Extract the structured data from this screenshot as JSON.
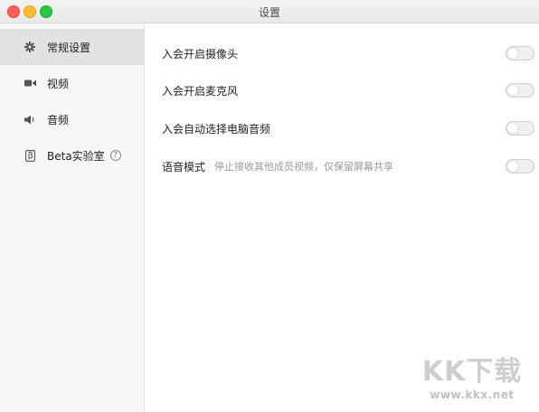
{
  "window": {
    "title": "设置",
    "colors": {
      "close": "#fe5f57",
      "minimize": "#febc2e",
      "maximize": "#28c840"
    }
  },
  "sidebar": {
    "items": [
      {
        "label": "常规设置",
        "icon": "gear-icon",
        "active": true
      },
      {
        "label": "视频",
        "icon": "video-camera-icon",
        "active": false
      },
      {
        "label": "音频",
        "icon": "speaker-icon",
        "active": false
      },
      {
        "label": "Beta实验室",
        "icon": "beta-icon",
        "active": false,
        "has_help": true
      }
    ]
  },
  "settings": {
    "rows": [
      {
        "label": "入会开启摄像头",
        "enabled": false
      },
      {
        "label": "入会开启麦克风",
        "enabled": false
      },
      {
        "label": "入会自动选择电脑音频",
        "enabled": false
      },
      {
        "label": "语音模式",
        "description": "停止接收其他成员视频，仅保留屏幕共享",
        "enabled": false
      }
    ]
  },
  "watermark": {
    "logo": "KK下载",
    "url": "www.kkx.net"
  }
}
